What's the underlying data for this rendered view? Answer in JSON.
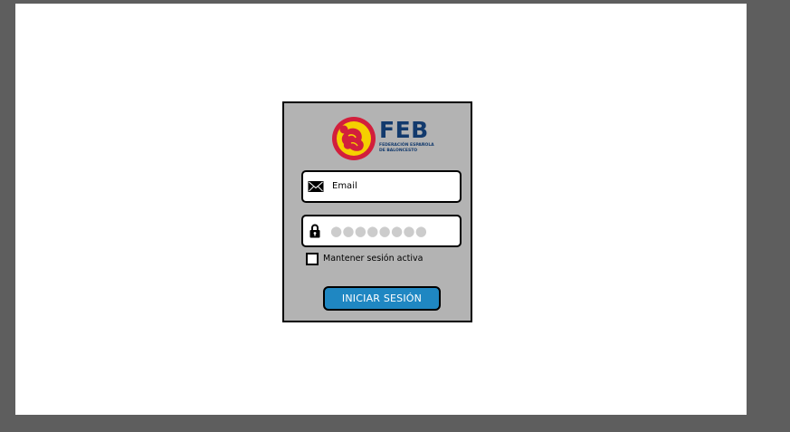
{
  "login": {
    "brand": {
      "name": "FEB",
      "subtitle": "FEDERACIÓN ESPAÑOLA\nDE BALONCESTO"
    },
    "email": {
      "placeholder": "Email",
      "icon": "envelope-icon"
    },
    "password": {
      "masked_value": "●●●●●●●●",
      "icon": "lock-icon"
    },
    "remember_me": {
      "label": "Mantener sesión activa",
      "checked": false
    },
    "submit_label": "INICIAR SESIÓN"
  },
  "colors": {
    "outer_background": "#5e5e5e",
    "canvas": "#ffffff",
    "card": "#b3b3b3",
    "button": "#1f87c2",
    "brand_navy": "#123a6d",
    "logo_red": "#d21f3c",
    "logo_yellow": "#f5d000"
  }
}
